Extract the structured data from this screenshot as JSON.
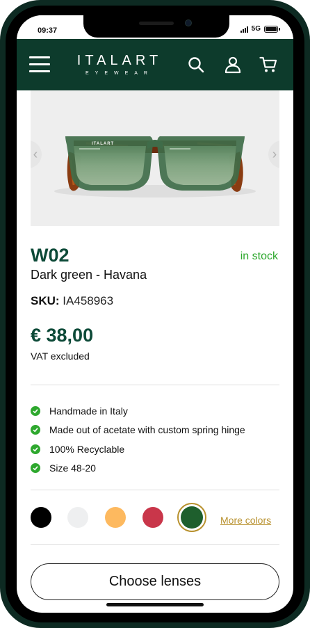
{
  "status_bar": {
    "time": "09:37",
    "network": "5G"
  },
  "header": {
    "brand": "ITALART",
    "brand_sub": "EYEWEAR",
    "icons": [
      "menu-icon",
      "search-icon",
      "user-icon",
      "cart-icon"
    ]
  },
  "product": {
    "model": "W02",
    "variant": "Dark green - Havana",
    "stock": "in stock",
    "sku_label": "SKU:",
    "sku_value": "IA458963",
    "price": "€ 38,00",
    "vat_note": "VAT excluded",
    "frame_print": "ITALART"
  },
  "features": [
    "Handmade in Italy",
    "Made out of acetate with custom spring hinge",
    "100% Recyclable",
    "Size 48-20"
  ],
  "swatches": [
    {
      "name": "black",
      "color": "#000000"
    },
    {
      "name": "white",
      "color": "#eeeff0"
    },
    {
      "name": "yellow",
      "color": "#fdb95f"
    },
    {
      "name": "red",
      "color": "#c9364a"
    },
    {
      "name": "dark-green",
      "color": "#1e5f2d",
      "selected": true
    }
  ],
  "more_colors": "More colors",
  "cta": "Choose lenses",
  "colors": {
    "header_bg": "#0d3b2c",
    "accent_green": "#0d4a38",
    "stock_green": "#2ea82e",
    "gold": "#b8912e"
  }
}
